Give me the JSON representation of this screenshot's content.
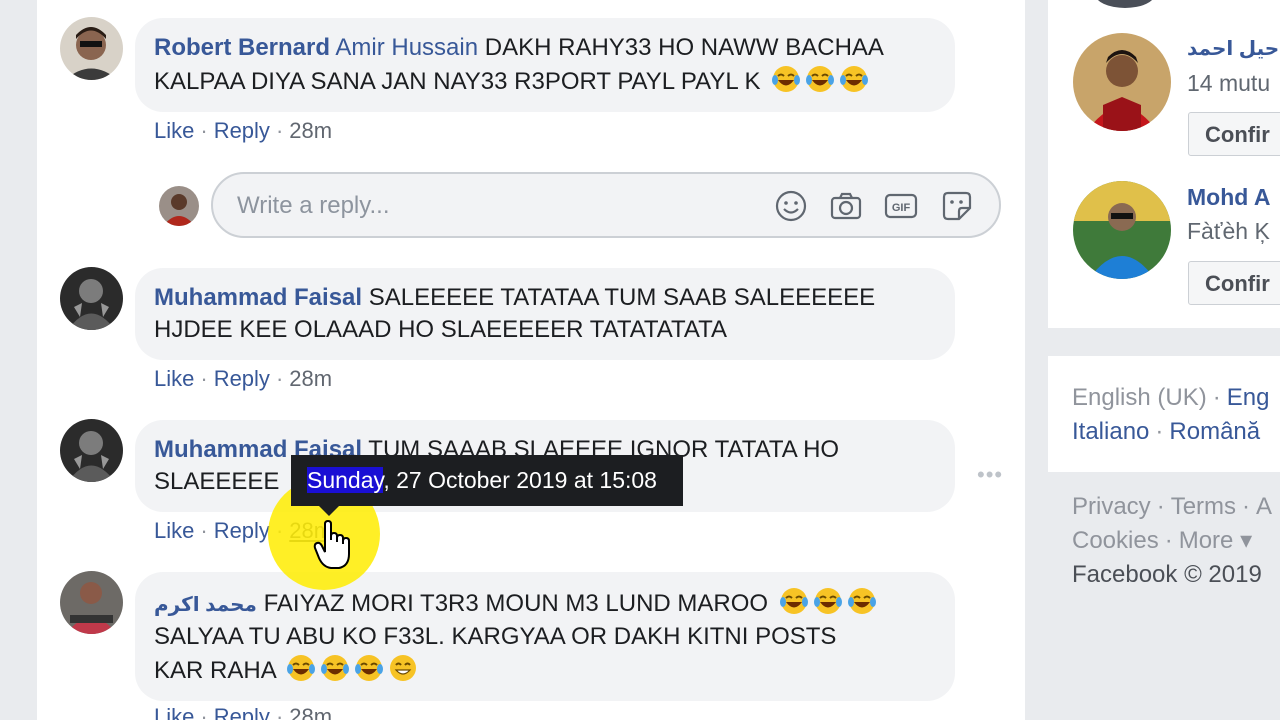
{
  "comments": [
    {
      "author": "Robert Bernard",
      "mention": "Amir Hussain",
      "text_line1": "DAKH RAHY33 HO NAWW BACHAA",
      "text_line2": "KALPAA DIYA SANA JAN NAY33 R3PORT PAYL PAYL K",
      "emojis": [
        "laughing-tears",
        "laughing-tears",
        "laughing-tears"
      ],
      "like": "Like",
      "reply": "Reply",
      "time": "28m"
    },
    {
      "author": "Muhammad Faisal",
      "text_line1": "SALEEEEE TATATAA TUM SAAB SALEEEEEE",
      "text_line2": "HJDEE KEE OLAAAD HO SLAEEEEER TATATATATA",
      "like": "Like",
      "reply": "Reply",
      "time": "28m"
    },
    {
      "author": "Muhammad Faisal",
      "text_line1": "TUM SAAAB SLAEEEE IGNOR TATATA HO",
      "text_line2": "SLAEEEEE",
      "like": "Like",
      "reply": "Reply",
      "time": "28m"
    },
    {
      "author": "محمد اکرم",
      "text_line1": "FAIYAZ MORI T3R3 MOUN M3 LUND MAROO",
      "text_line2": "SALYAA TU ABU KO F33L. KARGYAA OR DAKH KITNI POSTS",
      "text_line3": "KAR RAHA",
      "emojis_line1": [
        "laughing-tears",
        "laughing-tears",
        "laughing-tears"
      ],
      "emojis_line3": [
        "laughing-tears",
        "laughing-tears",
        "laughing-tears",
        "grinning"
      ],
      "like": "Like",
      "reply": "Reply",
      "time": "28m"
    }
  ],
  "composer": {
    "placeholder": "Write a reply...",
    "icons": [
      "smiley-icon",
      "camera-icon",
      "gif-icon",
      "sticker-icon"
    ]
  },
  "tooltip": {
    "highlight": "Sunday",
    "rest": ", 27 October 2019 at 15:08"
  },
  "sidebar": {
    "friend_requests": [
      {
        "name": "راحیل احمد",
        "sub": "14 mutu",
        "confirm": "Confir"
      },
      {
        "name": "Mohd A",
        "sub": "Fàťèh Ķ",
        "confirm": "Confir"
      }
    ],
    "languages": {
      "current": "English (UK)",
      "items": [
        "Eng",
        "Italiano",
        "Română"
      ]
    },
    "footer": {
      "links_row1": [
        "Privacy",
        "Terms",
        "A"
      ],
      "links_row2": [
        "Cookies",
        "More ▾"
      ],
      "copyright": "Facebook © 2019"
    }
  },
  "colors": {
    "link": "#385898",
    "bubble": "#f2f3f5",
    "tooltip_bg": "#1c1e21",
    "tooltip_highlight": "#1a0fd4",
    "cursor_highlight": "#ffec00"
  }
}
